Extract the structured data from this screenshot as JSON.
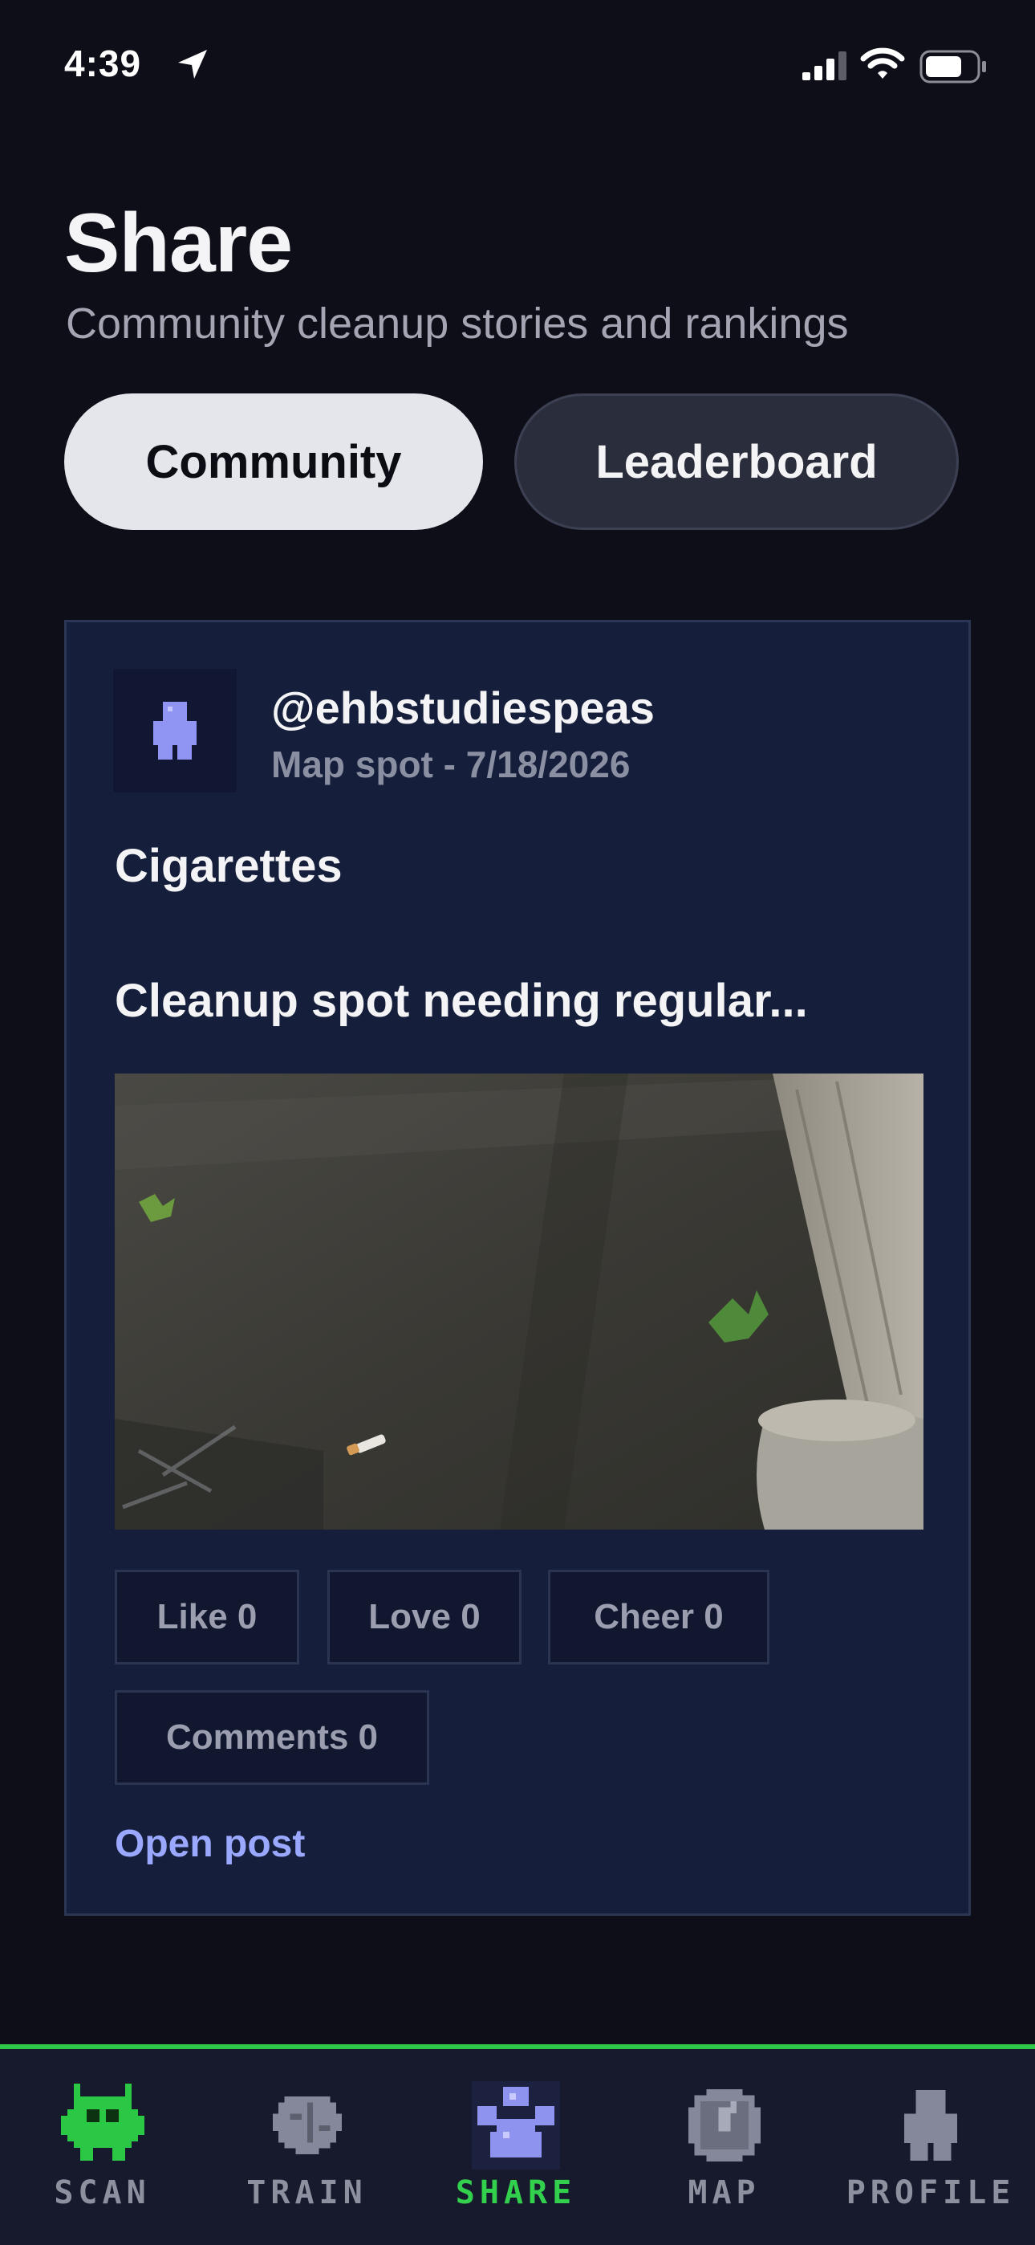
{
  "status_bar": {
    "time": "4:39",
    "icons": [
      "location-arrow-icon",
      "cellular-signal-icon",
      "wifi-icon",
      "battery-icon"
    ]
  },
  "header": {
    "title": "Share",
    "subtitle": "Community cleanup stories and rankings"
  },
  "tabs": [
    {
      "label": "Community",
      "active": true
    },
    {
      "label": "Leaderboard",
      "active": false
    }
  ],
  "post": {
    "username": "@ehbstudiespeas",
    "meta": "Map spot - 7/18/2026",
    "category": "Cigarettes",
    "description": "Cleanup spot needing regular...",
    "reactions": {
      "like": "Like 0",
      "love": "Love 0",
      "cheer": "Cheer 0",
      "comments": "Comments 0"
    },
    "open_link": "Open post"
  },
  "bottom_nav": {
    "items": [
      {
        "label": "SCAN",
        "icon": "alien-icon"
      },
      {
        "label": "TRAIN",
        "icon": "brain-icon"
      },
      {
        "label": "SHARE",
        "icon": "paw-icon",
        "active": true
      },
      {
        "label": "MAP",
        "icon": "compass-icon"
      },
      {
        "label": "PROFILE",
        "icon": "person-icon"
      }
    ]
  },
  "colors": {
    "background": "#0d0e17",
    "card": "#151f3b",
    "accent_green": "#33d04e",
    "accent_link": "#9aa8ff",
    "pixel_purple": "#8f93f0"
  }
}
